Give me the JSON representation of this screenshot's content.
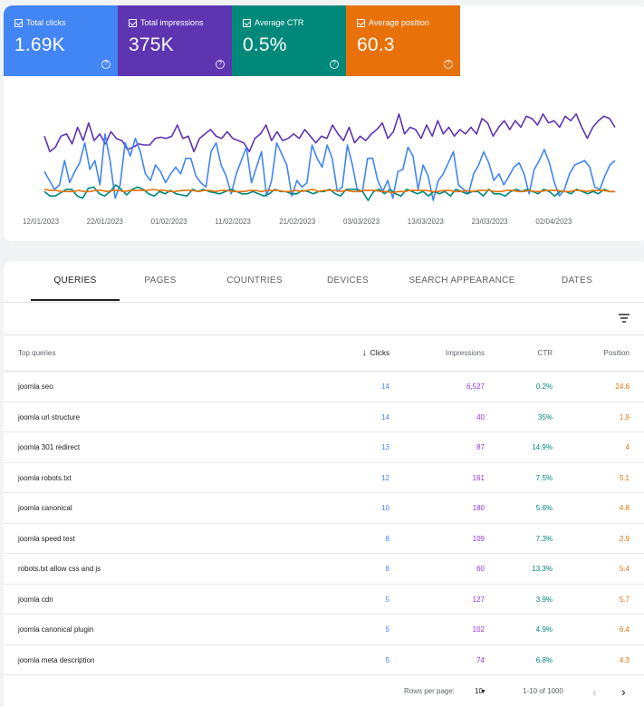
{
  "metrics": [
    {
      "label": "Total clicks",
      "value": "1.69K",
      "color": "#4285f4"
    },
    {
      "label": "Total impressions",
      "value": "375K",
      "color": "#5e35b1"
    },
    {
      "label": "Average CTR",
      "value": "0.5%",
      "color": "#00897b"
    },
    {
      "label": "Average position",
      "value": "60.3",
      "color": "#e8710a"
    }
  ],
  "chart_data": {
    "type": "line",
    "x_tick_labels": [
      "12/01/2023",
      "22/01/2023",
      "01/02/2023",
      "11/02/2023",
      "21/02/2023",
      "03/03/2023",
      "13/03/2023",
      "23/03/2023",
      "02/04/2023"
    ],
    "series": [
      {
        "name": "Total impressions",
        "color": "#5e35b1",
        "values": [
          62,
          48,
          52,
          62,
          64,
          55,
          70,
          58,
          74,
          58,
          64,
          55,
          66,
          60,
          58,
          50,
          52,
          55,
          54,
          54,
          60,
          61,
          60,
          62,
          72,
          60,
          62,
          48,
          60,
          64,
          68,
          62,
          60,
          66,
          60,
          58,
          56,
          48,
          60,
          64,
          72,
          58,
          66,
          58,
          60,
          64,
          60,
          68,
          62,
          56,
          62,
          60,
          72,
          64,
          58,
          70,
          56,
          62,
          58,
          64,
          68,
          74,
          60,
          66,
          82,
          64,
          70,
          68,
          60,
          72,
          62,
          76,
          64,
          70,
          62,
          68,
          64,
          70,
          64,
          78,
          74,
          62,
          70,
          76,
          68,
          76,
          70,
          80,
          78,
          72,
          82,
          74,
          76,
          70,
          80,
          76,
          82,
          70,
          60,
          70,
          76,
          80,
          78,
          70
        ]
      },
      {
        "name": "Total clicks",
        "color": "#4285f4",
        "values": [
          30,
          22,
          14,
          18,
          40,
          20,
          30,
          38,
          56,
          32,
          40,
          18,
          64,
          40,
          6,
          18,
          56,
          44,
          60,
          48,
          28,
          22,
          36,
          30,
          20,
          28,
          34,
          28,
          42,
          42,
          26,
          20,
          16,
          48,
          56,
          36,
          26,
          10,
          28,
          40,
          52,
          20,
          34,
          48,
          8,
          22,
          56,
          46,
          36,
          8,
          22,
          16,
          20,
          54,
          42,
          34,
          54,
          42,
          12,
          16,
          54,
          36,
          12,
          12,
          42,
          42,
          22,
          12,
          22,
          6,
          30,
          32,
          52,
          44,
          14,
          36,
          26,
          4,
          22,
          28,
          38,
          48,
          18,
          14,
          10,
          28,
          36,
          48,
          38,
          22,
          28,
          18,
          26,
          34,
          38,
          28,
          10,
          32,
          40,
          50,
          38,
          20,
          8,
          14,
          28,
          36,
          38,
          40,
          34,
          16,
          14,
          26,
          36,
          40
        ]
      },
      {
        "name": "Average CTR",
        "color": "#00897b",
        "values": [
          12,
          8,
          8,
          11,
          14,
          14,
          8,
          6,
          15,
          16,
          10,
          8,
          12,
          18,
          14,
          9,
          14,
          16,
          14,
          10,
          8,
          12,
          10,
          13,
          10,
          9,
          8,
          14,
          12,
          14,
          12,
          11,
          10,
          12,
          14,
          12,
          10,
          10,
          12,
          10,
          8,
          10,
          14,
          12,
          12,
          10,
          10,
          13,
          12,
          10,
          12,
          12,
          14,
          10,
          8,
          14,
          14,
          14,
          12,
          4,
          12,
          14,
          10,
          14,
          10,
          8,
          14,
          12,
          10,
          12,
          8,
          12,
          10,
          12,
          8,
          14,
          12,
          10,
          12,
          12,
          8,
          14,
          10,
          10,
          8,
          12,
          14,
          12,
          14,
          12,
          10,
          14,
          12,
          8,
          12,
          12,
          10,
          14,
          12,
          10,
          12,
          10,
          14,
          12,
          12
        ]
      },
      {
        "name": "Average position",
        "color": "#e8710a",
        "values": [
          14,
          13,
          13,
          12,
          12,
          12,
          13,
          12,
          12,
          13,
          13,
          12,
          13,
          13,
          12,
          13,
          13,
          13,
          13,
          14,
          13,
          13,
          12,
          12,
          13,
          13,
          13,
          12,
          13,
          13,
          12,
          13,
          13,
          12,
          12,
          12,
          13,
          13,
          12,
          13,
          13,
          13,
          12,
          12,
          13,
          12,
          13,
          14,
          12,
          13,
          13,
          13,
          12,
          13,
          12,
          12,
          13,
          13,
          13,
          12,
          12,
          11,
          12,
          12,
          13,
          13,
          13,
          13,
          12,
          12,
          13,
          13,
          12,
          12,
          13,
          12,
          13,
          13,
          13,
          12,
          12,
          13,
          13,
          12,
          12,
          13,
          12,
          12,
          13,
          13,
          13,
          12,
          12,
          13,
          13,
          12,
          13,
          13,
          13,
          12,
          12
        ]
      }
    ]
  },
  "tabs": [
    "QUERIES",
    "PAGES",
    "COUNTRIES",
    "DEVICES",
    "SEARCH APPEARANCE",
    "DATES"
  ],
  "table": {
    "headers": {
      "query": "Top queries",
      "clicks": "Clicks",
      "impressions": "Impressions",
      "ctr": "CTR",
      "position": "Position"
    },
    "rows": [
      {
        "query": "joomla seo",
        "clicks": "14",
        "impressions": "6,527",
        "ctr": "0.2%",
        "position": "24.6"
      },
      {
        "query": "joomla url structure",
        "clicks": "14",
        "impressions": "40",
        "ctr": "35%",
        "position": "1.9"
      },
      {
        "query": "joomla 301 redirect",
        "clicks": "13",
        "impressions": "87",
        "ctr": "14.9%",
        "position": "4"
      },
      {
        "query": "joomla robots.txt",
        "clicks": "12",
        "impressions": "161",
        "ctr": "7.5%",
        "position": "5.1"
      },
      {
        "query": "joomla canonical",
        "clicks": "10",
        "impressions": "180",
        "ctr": "5.6%",
        "position": "4.8"
      },
      {
        "query": "joomla speed test",
        "clicks": "8",
        "impressions": "109",
        "ctr": "7.3%",
        "position": "2.9"
      },
      {
        "query": "robots.txt allow css and js",
        "clicks": "8",
        "impressions": "60",
        "ctr": "13.3%",
        "position": "5.4"
      },
      {
        "query": "joomla cdn",
        "clicks": "5",
        "impressions": "127",
        "ctr": "3.9%",
        "position": "5.7"
      },
      {
        "query": "joomla canonical plugin",
        "clicks": "5",
        "impressions": "102",
        "ctr": "4.9%",
        "position": "6.4"
      },
      {
        "query": "joomla meta description",
        "clicks": "5",
        "impressions": "74",
        "ctr": "6.8%",
        "position": "4.3"
      }
    ]
  },
  "pager": {
    "rows_label": "Rows per page:",
    "rows_value": "10",
    "range": "1-10 of 1000"
  }
}
